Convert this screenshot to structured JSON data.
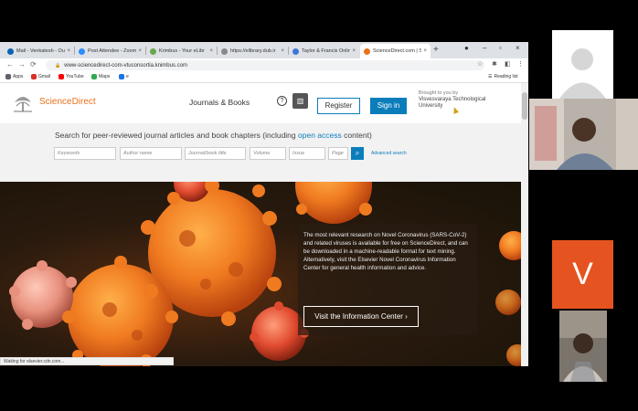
{
  "browser": {
    "tabs": [
      {
        "title": "Mail - Venkatesh - Ou",
        "favicon_color": "#0a64b4",
        "active": false
      },
      {
        "title": "Post Attendee - Zoom",
        "favicon_color": "#2d8cff",
        "active": false
      },
      {
        "title": "Krimbus - Your eLibr",
        "favicon_color": "#6aa84f",
        "active": false
      },
      {
        "title": "https://elibrary.dub.ir",
        "favicon_color": "#888888",
        "active": false
      },
      {
        "title": "Taylor & Francis Onlin",
        "favicon_color": "#3c78d8",
        "active": false
      },
      {
        "title": "ScienceDirect.com | S",
        "favicon_color": "#e9711c",
        "active": true
      }
    ],
    "url": "www-sciencedirect-com-vtuconsortia.knimbus.com",
    "bookmarks": [
      {
        "label": "Apps",
        "color": "#5f6368"
      },
      {
        "label": "Gmail",
        "color": "#d93025"
      },
      {
        "label": "YouTube",
        "color": "#ff0000"
      },
      {
        "label": "Maps",
        "color": "#34a853"
      },
      {
        "label": "e",
        "color": "#1a73e8"
      }
    ],
    "reading_list": "Reading list",
    "status": "Waiting for elsevier.cdn.com..."
  },
  "sciencedirect": {
    "logo": "ScienceDirect",
    "nav_journals": "Journals & Books",
    "help_icon": "?",
    "register": "Register",
    "signin": "Sign in",
    "brought_by": "Brought to you by",
    "institution": "Visvesvaraya Technological University",
    "search_heading_pre": "Search for peer-reviewed journal articles and book chapters (including ",
    "search_heading_link": "open access",
    "search_heading_post": " content)",
    "fields": [
      "Keywords",
      "Author name",
      "Journal/book title",
      "Volume",
      "Issue",
      "Page"
    ],
    "advanced": "Advanced search",
    "hero_text_1": "The most relevant research on Novel Coronavirus (SARS-CoV-2) and related viruses is available for free on ScienceDirect, and can be downloaded in a machine-readable format for text mining.",
    "hero_text_2": "Alternatively, visit the Elsevier Novel Coronavirus Information Center for general health information and advice.",
    "hero_button": "Visit the Information Center ›"
  },
  "meeting": {
    "participant_initial": "V",
    "accent_color": "#e55420"
  }
}
